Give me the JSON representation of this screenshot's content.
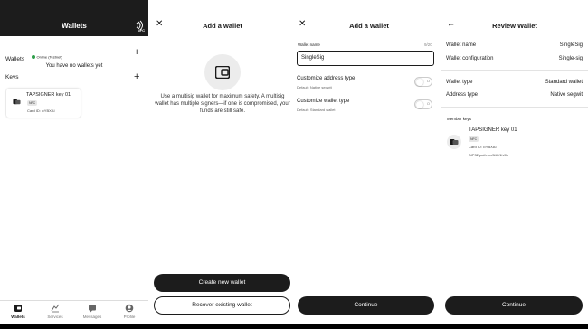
{
  "panel1": {
    "title": "Wallets",
    "nfc_label": "NFC",
    "wallets_label": "Wallets",
    "online_status": "Online (Testnet)",
    "online_color": "#2e9e4a",
    "empty_wallets": "You have no wallets yet",
    "keys_label": "Keys",
    "key_card": {
      "name": "TAPSIGNER key 01",
      "badge": "NFC",
      "card_id": "Card ID: ••YBXAI"
    },
    "tabs": [
      {
        "label": "Wallets",
        "icon": "wallet-icon",
        "active": true
      },
      {
        "label": "Services",
        "icon": "services-icon",
        "active": false
      },
      {
        "label": "Messages",
        "icon": "messages-icon",
        "active": false
      },
      {
        "label": "Profile",
        "icon": "profile-icon",
        "active": false
      }
    ]
  },
  "panel2": {
    "title": "Add a wallet",
    "info": "Use a multisig wallet for maximum safety. A multisig wallet has multiple signers—if one is compromised, your funds are still safe.",
    "create_button": "Create new wallet",
    "recover_button": "Recover existing wallet"
  },
  "panel3": {
    "title": "Add a wallet",
    "wallet_name_label": "Wallet name",
    "wallet_name_count": "9/20",
    "wallet_name_value": "SingleSig",
    "address_type_title": "Customize address type",
    "address_type_sub": "Default: Native segwit",
    "wallet_type_title": "Customize wallet type",
    "wallet_type_sub": "Default: Standard wallet",
    "toggle_off": "O",
    "continue_button": "Continue"
  },
  "panel4": {
    "title": "Review Wallet",
    "rows_top": [
      {
        "label": "Wallet name",
        "value": "SingleSig"
      },
      {
        "label": "Wallet configuration",
        "value": "Single-sig"
      }
    ],
    "rows_mid": [
      {
        "label": "Wallet type",
        "value": "Standard wallet"
      },
      {
        "label": "Address type",
        "value": "Native segwit"
      }
    ],
    "member_keys_label": "Member keys",
    "member_key": {
      "name": "TAPSIGNER key 01",
      "badge": "NFC",
      "card_id": "Card ID: ••YBXAI",
      "bip32": "BIP32 path: m/84h/1h/0h"
    },
    "continue_button": "Continue"
  }
}
